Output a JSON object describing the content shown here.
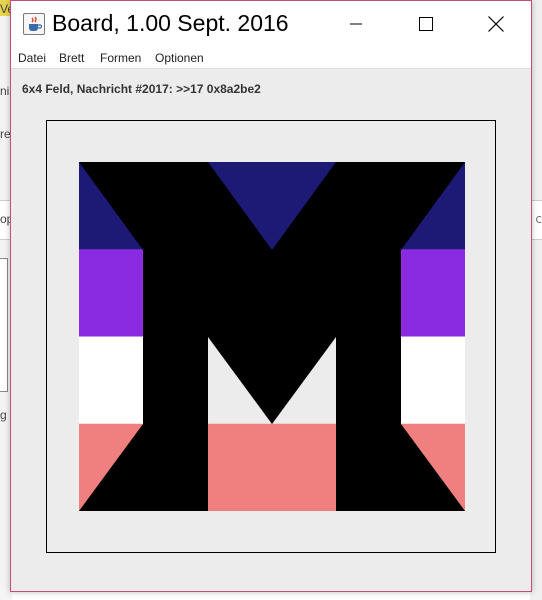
{
  "window": {
    "title": "Board, 1.00 Sept. 2016",
    "controls": {
      "minimize": "minimize-icon",
      "maximize": "maximize-icon",
      "close": "close-icon"
    }
  },
  "menu": {
    "items": [
      "Datei",
      "Brett",
      "Formen",
      "Optionen"
    ]
  },
  "status": {
    "message": "6x4 Feld, Nachricht #2017: >>17 0x8a2be2"
  },
  "board": {
    "columns": 6,
    "rows": 4,
    "colors": {
      "navy": "#1c1a74",
      "purple": "#8a2be2",
      "white": "#ffffff",
      "salmon": "#f08080",
      "black": "#000000",
      "light": "#ececec"
    },
    "grid": [
      [
        "navy",
        "black",
        "navy",
        "navy",
        "black",
        "navy"
      ],
      [
        "purple",
        "black",
        "black",
        "black",
        "black",
        "purple"
      ],
      [
        "white",
        "black",
        "light",
        "light",
        "black",
        "white"
      ],
      [
        "salmon",
        "black",
        "salmon",
        "salmon",
        "black",
        "salmon"
      ]
    ]
  },
  "background": {
    "left_fragments": [
      "Ve",
      "ni",
      "re",
      "op",
      "g"
    ],
    "right_fragment": "c"
  },
  "colors": {
    "window_bg": "#ececec",
    "titlebar_bg": "#ffffff",
    "border_accent": "#c84b78"
  }
}
